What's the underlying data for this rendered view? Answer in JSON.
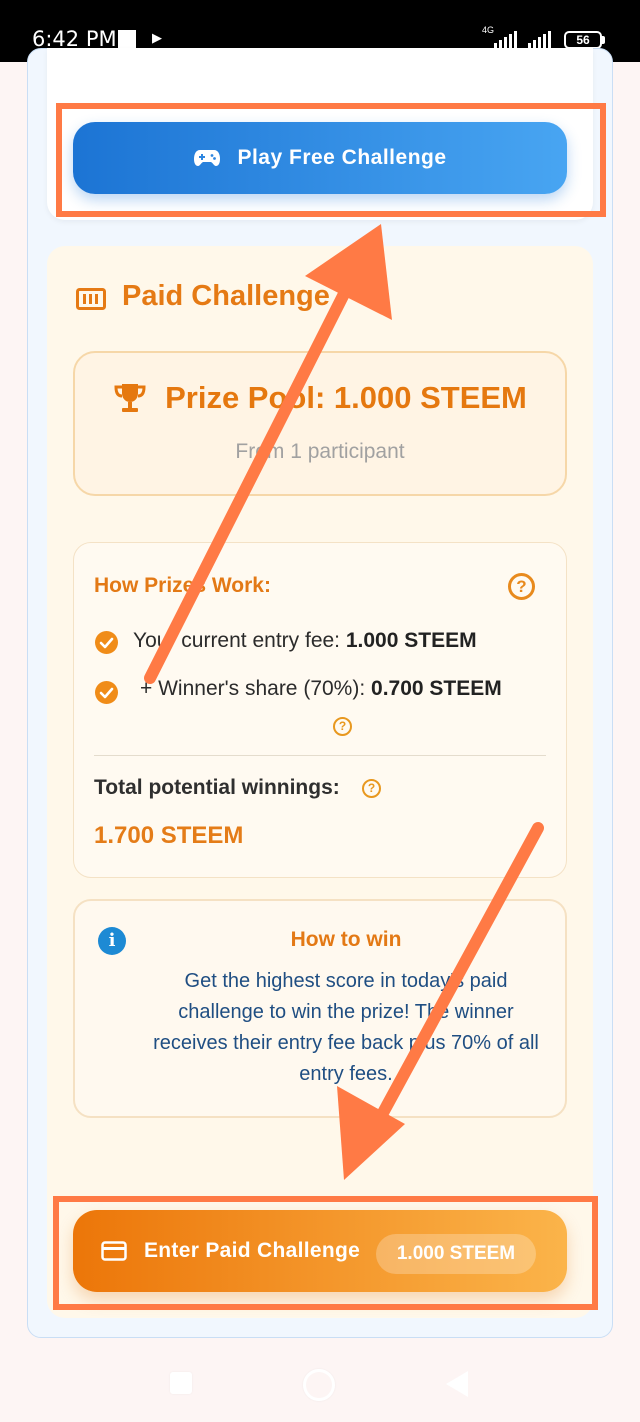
{
  "status_bar": {
    "time": "6:42 PM",
    "network": "4G",
    "battery": "56"
  },
  "free": {
    "button_label": "Play Free Challenge",
    "icon": "gamepad-icon"
  },
  "paid": {
    "title": "Paid Challenge",
    "prize_pool": "Prize Pool: 1.000 STEEM",
    "prize_sub": "From 1 participant",
    "how_title": "How Prizes Work:",
    "entry_fee_label": "Your current entry fee: ",
    "entry_fee_value": "1.000 STEEM",
    "winner_share_label": "+ Winner's share (70%): ",
    "winner_share_value": "0.700 STEEM",
    "total_label": "Total potential winnings:",
    "total_value": "1.700 STEEM",
    "win_title": "How to win",
    "win_desc": "Get the highest score in today's paid challenge to win the prize! The winner receives their entry fee back plus 70% of all entry fees.",
    "button_label": "Enter Paid Challenge",
    "button_price": "1.000 STEEM"
  },
  "colors": {
    "accent_orange": "#e57a14",
    "free_blue": "#1c74d4",
    "annotation": "#ff7a45"
  }
}
